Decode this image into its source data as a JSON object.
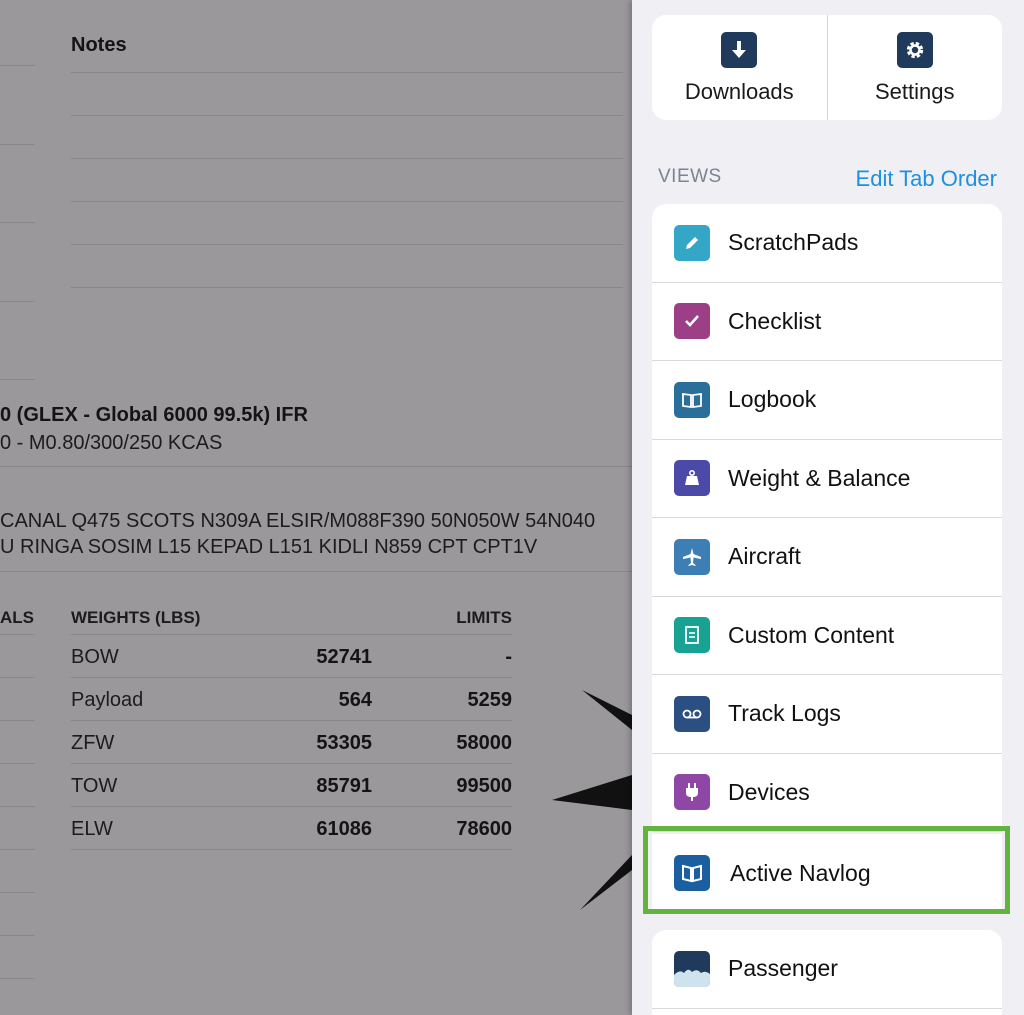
{
  "background_doc": {
    "notes_header": "Notes",
    "route_title": "0 (GLEX - Global 6000 99.5k) IFR",
    "route_subtitle": "0 - M0.80/300/250 KCAS",
    "route_line_1": "CANAL Q475 SCOTS N309A ELSIR/M088F390 50N050W 54N040",
    "route_line_2": "U RINGA SOSIM L15 KEPAD L151 KIDLI N859 CPT CPT1V",
    "partial_header": "ALS",
    "weights_header": "WEIGHTS (LBS)",
    "limits_header": "LIMITS",
    "weights": [
      {
        "label": "BOW",
        "value": "52741",
        "limit": "-"
      },
      {
        "label": "Payload",
        "value": "564",
        "limit": "5259"
      },
      {
        "label": "ZFW",
        "value": "53305",
        "limit": "58000"
      },
      {
        "label": "TOW",
        "value": "85791",
        "limit": "99500"
      },
      {
        "label": "ELW",
        "value": "61086",
        "limit": "78600"
      }
    ]
  },
  "panel": {
    "top_buttons": [
      {
        "label": "Downloads",
        "icon": "download-icon"
      },
      {
        "label": "Settings",
        "icon": "gear-icon"
      }
    ],
    "views_header": "VIEWS",
    "edit_tab_order": "Edit Tab Order",
    "items": [
      {
        "label": "ScratchPads",
        "icon": "pencil-icon",
        "color": "#35a7c6"
      },
      {
        "label": "Checklist",
        "icon": "checkmark-icon",
        "color": "#9c3f86"
      },
      {
        "label": "Logbook",
        "icon": "book-icon",
        "color": "#2a6f99"
      },
      {
        "label": "Weight & Balance",
        "icon": "weight-icon",
        "color": "#4c4aa8"
      },
      {
        "label": "Aircraft",
        "icon": "airplane-icon",
        "color": "#3d7fb5"
      },
      {
        "label": "Custom Content",
        "icon": "document-icon",
        "color": "#17a294"
      },
      {
        "label": "Track Logs",
        "icon": "voicemail-icon",
        "color": "#2c4f83"
      },
      {
        "label": "Devices",
        "icon": "plug-icon",
        "color": "#8f47a5"
      }
    ],
    "active_item": {
      "label": "Active Navlog",
      "icon": "open-book-icon",
      "color": "#1b5fa0"
    },
    "passenger": {
      "label": "Passenger",
      "icon": "passenger-icon"
    },
    "highlight_color": "#63b33f"
  }
}
